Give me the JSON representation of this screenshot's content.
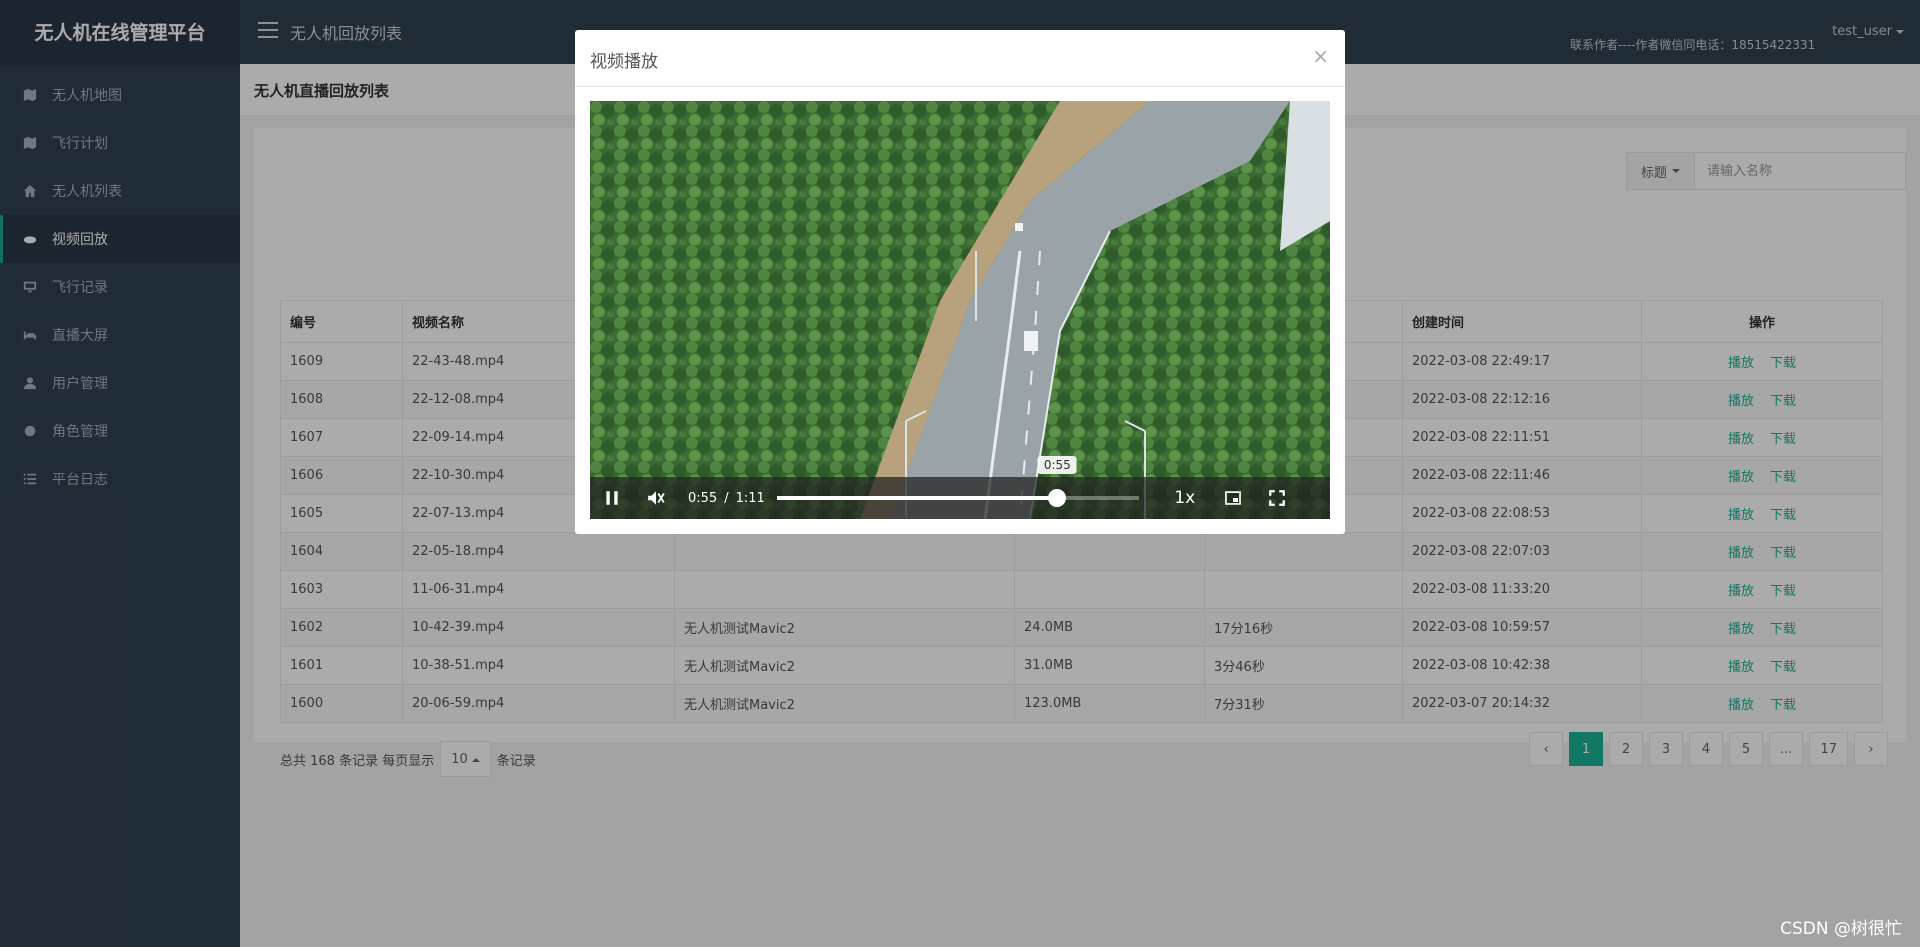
{
  "app": {
    "brand": "无人机在线管理平台"
  },
  "topbar": {
    "page_heading": "无人机回放列表",
    "contact": "联系作者----作者微信同电话：18515422331",
    "user": "test_user"
  },
  "sidebar": {
    "items": [
      {
        "label": "无人机地图",
        "icon": "map-icon"
      },
      {
        "label": "飞行计划",
        "icon": "map-icon"
      },
      {
        "label": "无人机列表",
        "icon": "home-icon"
      },
      {
        "label": "视频回放",
        "icon": "drone-icon",
        "active": true
      },
      {
        "label": "飞行记录",
        "icon": "monitor-icon"
      },
      {
        "label": "直播大屏",
        "icon": "bed-icon"
      },
      {
        "label": "用户管理",
        "icon": "user-icon"
      },
      {
        "label": "角色管理",
        "icon": "role-icon"
      },
      {
        "label": "平台日志",
        "icon": "list-icon"
      }
    ]
  },
  "content": {
    "header": "无人机直播回放列表"
  },
  "search": {
    "filter_label": "标题",
    "placeholder": "请输入名称"
  },
  "table": {
    "headers": {
      "id": "编号",
      "name": "视频名称",
      "desc": "",
      "size": "",
      "duration": "",
      "created": "创建时间",
      "action": "操作"
    },
    "action_play": "播放",
    "action_download": "下载",
    "rows": [
      {
        "id": "1609",
        "name": "22-43-48.mp4",
        "desc": "",
        "size": "",
        "duration": "",
        "created": "2022-03-08 22:49:17"
      },
      {
        "id": "1608",
        "name": "22-12-08.mp4",
        "desc": "",
        "size": "",
        "duration": "",
        "created": "2022-03-08 22:12:16"
      },
      {
        "id": "1607",
        "name": "22-09-14.mp4",
        "desc": "",
        "size": "",
        "duration": "",
        "created": "2022-03-08 22:11:51"
      },
      {
        "id": "1606",
        "name": "22-10-30.mp4",
        "desc": "",
        "size": "",
        "duration": "",
        "created": "2022-03-08 22:11:46"
      },
      {
        "id": "1605",
        "name": "22-07-13.mp4",
        "desc": "",
        "size": "",
        "duration": "",
        "created": "2022-03-08 22:08:53"
      },
      {
        "id": "1604",
        "name": "22-05-18.mp4",
        "desc": "",
        "size": "",
        "duration": "",
        "created": "2022-03-08 22:07:03"
      },
      {
        "id": "1603",
        "name": "11-06-31.mp4",
        "desc": "",
        "size": "",
        "duration": "",
        "created": "2022-03-08 11:33:20"
      },
      {
        "id": "1602",
        "name": "10-42-39.mp4",
        "desc": "无人机测试Mavic2",
        "size": "24.0MB",
        "duration": "17分16秒",
        "created": "2022-03-08 10:59:57"
      },
      {
        "id": "1601",
        "name": "10-38-51.mp4",
        "desc": "无人机测试Mavic2",
        "size": "31.0MB",
        "duration": "3分46秒",
        "created": "2022-03-08 10:42:38"
      },
      {
        "id": "1600",
        "name": "20-06-59.mp4",
        "desc": "无人机测试Mavic2",
        "size": "123.0MB",
        "duration": "7分31秒",
        "created": "2022-03-07 20:14:32"
      }
    ]
  },
  "pager": {
    "prefix": "总共 168 条记录  每页显示",
    "page_size": "10",
    "suffix": "条记录",
    "prev": "‹",
    "next": "›",
    "pages": [
      "1",
      "2",
      "3",
      "4",
      "5",
      "...",
      "17"
    ],
    "current": "1"
  },
  "modal": {
    "title": "视频播放",
    "close": "×",
    "player": {
      "current_time": "0:55",
      "duration": "1:11",
      "hover_time": "0:55",
      "speed": "1x",
      "progress_fraction": 0.775,
      "muted": true,
      "playing": true
    }
  },
  "watermark": "CSDN @树很忙",
  "colors": {
    "accent": "#1ab394",
    "sidebar_bg": "#2f4050"
  }
}
